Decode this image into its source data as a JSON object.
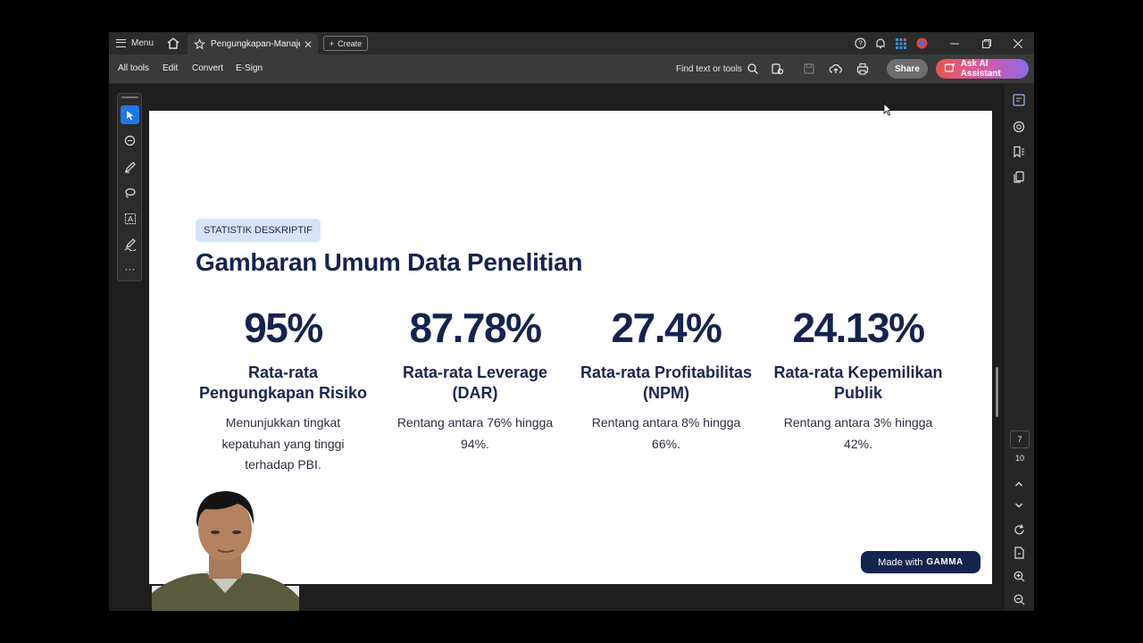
{
  "titlebar": {
    "menu_label": "Menu",
    "tab_label": "Pengungkapan-Manaje...",
    "create_label": "Create"
  },
  "toolbar": {
    "items": [
      "All tools",
      "Edit",
      "Convert",
      "E-Sign"
    ],
    "find_label": "Find text or tools",
    "share_label": "Share",
    "ai_label": "Ask AI Assistant"
  },
  "slide": {
    "badge": "STATISTIK DESKRIPTIF",
    "title": "Gambaran Umum Data Penelitian",
    "stats": [
      {
        "value": "95%",
        "label_1": "Rata-rata",
        "label_2": "Pengungkapan Risiko",
        "desc_1": "Menunjukkan tingkat",
        "desc_2": "kepatuhan yang tinggi",
        "desc_3": "terhadap PBI."
      },
      {
        "value": "87.78%",
        "label_1": "Rata-rata Leverage",
        "label_2": "(DAR)",
        "desc_1": "Rentang antara 76% hingga",
        "desc_2": "94%.",
        "desc_3": ""
      },
      {
        "value": "27.4%",
        "label_1": "Rata-rata Profitabilitas",
        "label_2": "(NPM)",
        "desc_1": "Rentang antara 8% hingga",
        "desc_2": "66%.",
        "desc_3": ""
      },
      {
        "value": "24.13%",
        "label_1": "Rata-rata Kepemilikan",
        "label_2": "Publik",
        "desc_1": "Rentang antara 3% hingga",
        "desc_2": "42%.",
        "desc_3": ""
      }
    ],
    "made_with": "Made with",
    "brand": "GAMMA"
  },
  "pagination": {
    "current": "7",
    "total": "10"
  },
  "colors": {
    "accent": "#1f78e6",
    "title": "#14244f",
    "badge_bg": "#d5e4f7"
  }
}
